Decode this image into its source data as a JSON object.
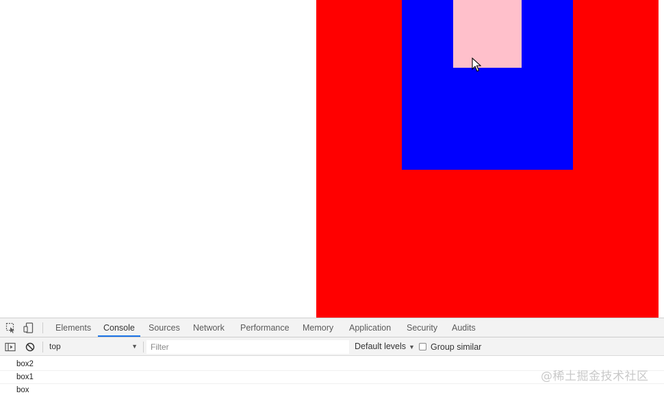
{
  "page": {
    "colors": {
      "outer_box": "#ff0000",
      "middle_box": "#0000ff",
      "inner_box": "#ffc0cb"
    },
    "boxes": [
      "box",
      "box1",
      "box2"
    ]
  },
  "devtools": {
    "toolbar_icons": [
      "inspect-element-icon",
      "device-toolbar-icon"
    ],
    "tabs": [
      {
        "label": "Elements",
        "active": false
      },
      {
        "label": "Console",
        "active": true
      },
      {
        "label": "Sources",
        "active": false
      },
      {
        "label": "Network",
        "active": false
      },
      {
        "label": "Performance",
        "active": false
      },
      {
        "label": "Memory",
        "active": false
      },
      {
        "label": "Application",
        "active": false
      },
      {
        "label": "Security",
        "active": false
      },
      {
        "label": "Audits",
        "active": false
      }
    ],
    "accent_color": "#1a73e8",
    "console_toolbar": {
      "sidebar_icon": "show-sidebar-icon",
      "clear_icon": "clear-console-icon",
      "context": "top",
      "filter_placeholder": "Filter",
      "levels": "Default levels",
      "group_similar": "Group similar",
      "group_similar_checked": false
    },
    "messages": [
      "box2",
      "box1",
      "box"
    ]
  },
  "watermark": "@稀土掘金技术社区"
}
